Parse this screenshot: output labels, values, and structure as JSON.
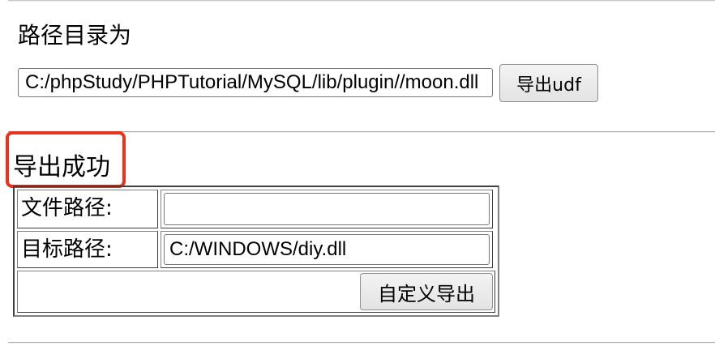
{
  "export_udf_section": {
    "path_label": "路径目录为",
    "path_value": "C:/phpStudy/PHPTutorial/MySQL/lib/plugin//moon.dll",
    "export_button_label": "导出udf"
  },
  "status": {
    "message": "导出成功",
    "highlight_color": "#e8321b"
  },
  "custom_export_form": {
    "file_path_label": "文件路径:",
    "file_path_value": "",
    "target_path_label": "目标路径:",
    "target_path_value": "C:/WINDOWS/diy.dll",
    "submit_label": "自定义导出"
  }
}
